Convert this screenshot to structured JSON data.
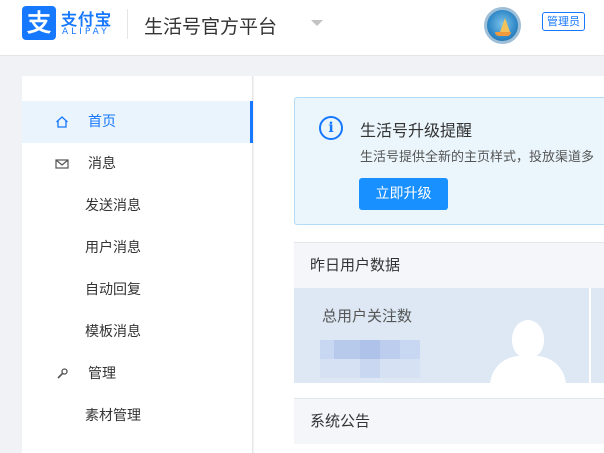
{
  "header": {
    "logo_glyph": "支",
    "logo_cn": "支付宝",
    "logo_en": "ALIPAY",
    "platform_title": "生活号官方平台",
    "role_badge": "管理员"
  },
  "sidebar": {
    "items": [
      {
        "label": "首页",
        "icon": "home-icon",
        "active": true
      },
      {
        "label": "消息",
        "icon": "mail-icon",
        "active": false
      },
      {
        "label": "发送消息",
        "sub": true
      },
      {
        "label": "用户消息",
        "sub": true
      },
      {
        "label": "自动回复",
        "sub": true
      },
      {
        "label": "模板消息",
        "sub": true
      },
      {
        "label": "管理",
        "icon": "wrench-icon",
        "active": false
      },
      {
        "label": "素材管理",
        "sub": true
      }
    ]
  },
  "main": {
    "upgrade": {
      "icon": "info-icon",
      "title": "生活号升级提醒",
      "description": "生活号提供全新的主页样式，投放渠道多",
      "button_label": "立即升级"
    },
    "yesterday": {
      "title": "昨日用户数据",
      "stat_label": "总用户关注数"
    },
    "announcement": {
      "title": "系统公告"
    }
  },
  "colors": {
    "brand": "#1677ff",
    "active_bg": "#eaf4fd",
    "card_bg": "#dde8f4"
  }
}
